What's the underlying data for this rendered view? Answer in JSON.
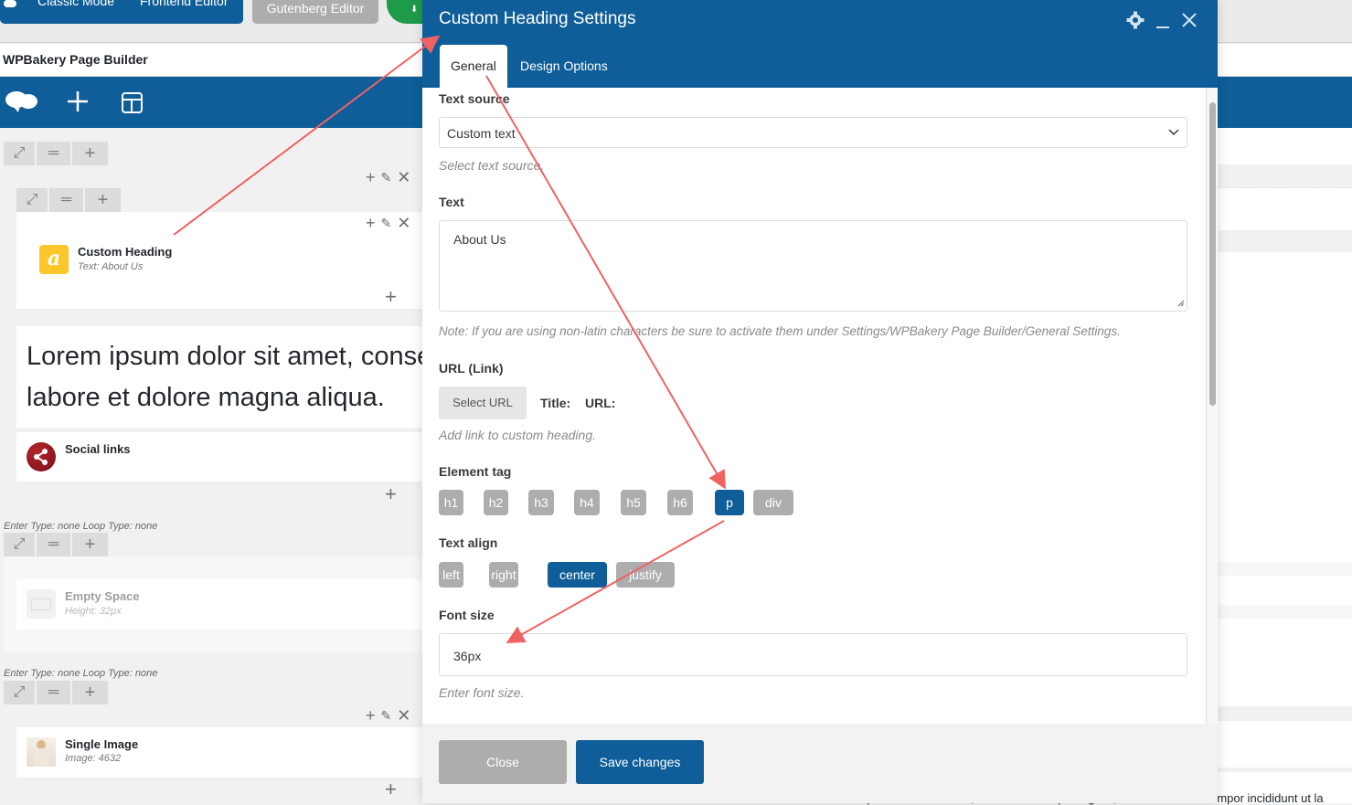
{
  "top_modes": {
    "classic": "Classic Mode",
    "frontend": "Frontend Editor",
    "gutenberg": "Gutenberg Editor"
  },
  "builder": {
    "title": "WPBakery Page Builder",
    "elements": {
      "custom_heading": {
        "title": "Custom Heading",
        "subtitle": "Text: About Us"
      },
      "lorem_line1": "Lorem ipsum dolor sit amet, conse",
      "lorem_line2": "labore et dolore magna aliqua.",
      "social_links": {
        "title": "Social links"
      },
      "empty_space": {
        "title": "Empty Space",
        "subtitle": "Height: 32px"
      },
      "single_image": {
        "title": "Single Image",
        "subtitle": "Image: 4632"
      }
    },
    "row_meta_1": "Enter Type: none  Loop Type: none",
    "row_meta_2": "Enter Type: none  Loop Type: none",
    "bottom_right_text": "Lorem ipsum dolor sit amet, consectetur adipiscing elit, sed do eiusmod tempor incididunt ut la"
  },
  "modal": {
    "title": "Custom Heading Settings",
    "tabs": [
      {
        "label": "General",
        "active": true
      },
      {
        "label": "Design Options",
        "active": false
      }
    ],
    "fields": {
      "text_source": {
        "label": "Text source",
        "value": "Custom text",
        "hint": "Select text source."
      },
      "text": {
        "label": "Text",
        "value": "About Us",
        "hint": "Note: If you are using non-latin characters be sure to activate them under Settings/WPBakery Page Builder/General Settings."
      },
      "url": {
        "label": "URL (Link)",
        "button": "Select URL",
        "title_label": "Title:",
        "url_label": "URL:",
        "hint": "Add link to custom heading."
      },
      "element_tag": {
        "label": "Element tag",
        "options": [
          "h1",
          "h2",
          "h3",
          "h4",
          "h5",
          "h6",
          "p",
          "div"
        ],
        "selected": "p"
      },
      "text_align": {
        "label": "Text align",
        "options": [
          "left",
          "right",
          "center",
          "justify"
        ],
        "selected": "center"
      },
      "font_size": {
        "label": "Font size",
        "value": "36px",
        "hint": "Enter font size."
      }
    },
    "footer": {
      "close": "Close",
      "save": "Save changes"
    }
  },
  "colors": {
    "brand_blue": "#0f5e99",
    "inactive_gray": "#adadad",
    "annotation_red": "#f06262",
    "heading_icon_yellow": "#fcc72b",
    "social_icon_red": "#8e1b23"
  }
}
